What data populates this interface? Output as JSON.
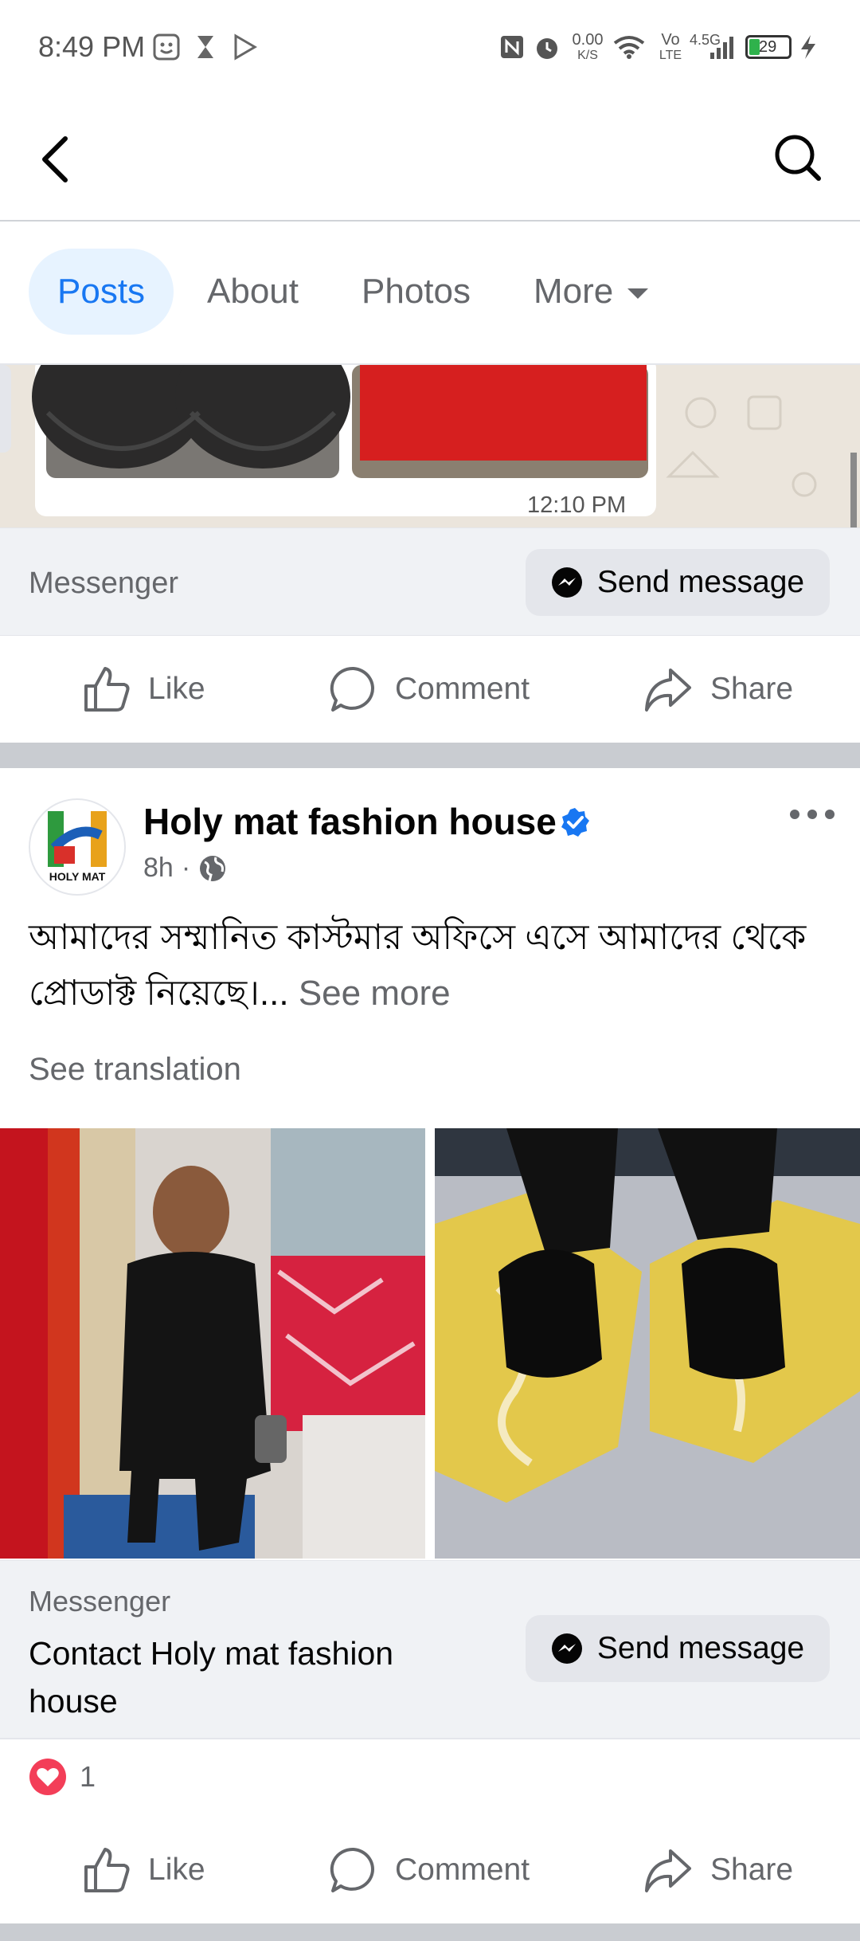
{
  "status_bar": {
    "time": "8:49 PM",
    "net_speed_top": "0.00",
    "net_speed_bottom": "K/S",
    "volte_top": "Vo",
    "volte_bottom": "LTE",
    "network": "4.5G",
    "battery": "29"
  },
  "nav": {
    "back_icon": "chevron-left-icon",
    "search_icon": "search-icon"
  },
  "tabs": [
    {
      "label": "Posts",
      "active": true
    },
    {
      "label": "About",
      "active": false
    },
    {
      "label": "Photos",
      "active": false
    },
    {
      "label": "More",
      "active": false
    }
  ],
  "post1": {
    "image_timestamp": "12:10 PM",
    "messenger_label": "Messenger",
    "send_button": "Send message",
    "actions": {
      "like": "Like",
      "comment": "Comment",
      "share": "Share"
    }
  },
  "post2": {
    "page_name": "Holy mat fashion house",
    "avatar_text": "HOLY MAT",
    "time": "8h",
    "dot": "·",
    "text": "আমাদের সম্মানিত কাস্টমার অফিসে এসে আমাদের থেকে প্রোডাক্ট নিয়েছে।...",
    "see_more": "See more",
    "see_translation": "See translation",
    "messenger_label": "Messenger",
    "contact_label": "Contact Holy mat fashion house",
    "send_button": "Send message",
    "reaction_count": "1",
    "actions": {
      "like": "Like",
      "comment": "Comment",
      "share": "Share"
    }
  },
  "colors": {
    "accent": "#1877f2",
    "tab_active_bg": "#e7f3ff",
    "secondary_text": "#65676b",
    "love_reaction": "#f33e58"
  }
}
